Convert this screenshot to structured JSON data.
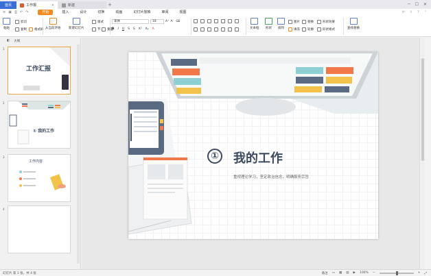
{
  "tabs": {
    "home": "首页",
    "doc": "工作报",
    "new": "新建",
    "add": "+"
  },
  "menu": {
    "items": [
      "开始",
      "插入",
      "设计",
      "切换",
      "动画",
      "幻灯片放映",
      "审阅",
      "视图"
    ],
    "active_index": 0
  },
  "ribbon": {
    "paste": "粘贴",
    "cut": "剪切",
    "copy": "复制",
    "format_painter": "格式刷",
    "from_current": "从当前开始",
    "new_slide": "新建幻灯片",
    "layout": "版式",
    "section": "节",
    "reset": "重置",
    "font_value": "宋体",
    "size_value": "18",
    "bold": "B",
    "italic": "I",
    "underline": "U",
    "textbox": "文本框",
    "shape": "形状",
    "arrange": "排列",
    "picture": "图片",
    "fill": "填充",
    "outline": "轮廓",
    "replace": "替换",
    "select": "选择",
    "shape_effects": "形状效果",
    "shape_format": "形状格式",
    "find_replace": "查找替换"
  },
  "left_panel": {
    "header": "大纲",
    "thumbs": [
      {
        "num": "1",
        "title": "工作汇报"
      },
      {
        "num": "2",
        "title": "① 我的工作"
      },
      {
        "num": "3",
        "title": "工作内容"
      },
      {
        "num": "4",
        "title": ""
      }
    ]
  },
  "slide": {
    "number": "①",
    "title": "我的工作",
    "subtitle": "重视理论学习，坚定政治信念，明确服务宗旨"
  },
  "status": {
    "left": "幻灯片 第 1 张，共 4 张",
    "notes": "备注",
    "zoom": "100%"
  },
  "colors": {
    "tab_active": "#3b6fd8",
    "menu_active": "#f28a1f",
    "slide_title": "#3b4a5e",
    "bar_orange": "#f0784a",
    "bar_blue": "#5a6a82",
    "bar_yellow": "#f3c24b",
    "bar_teal": "#8fd0d4"
  }
}
